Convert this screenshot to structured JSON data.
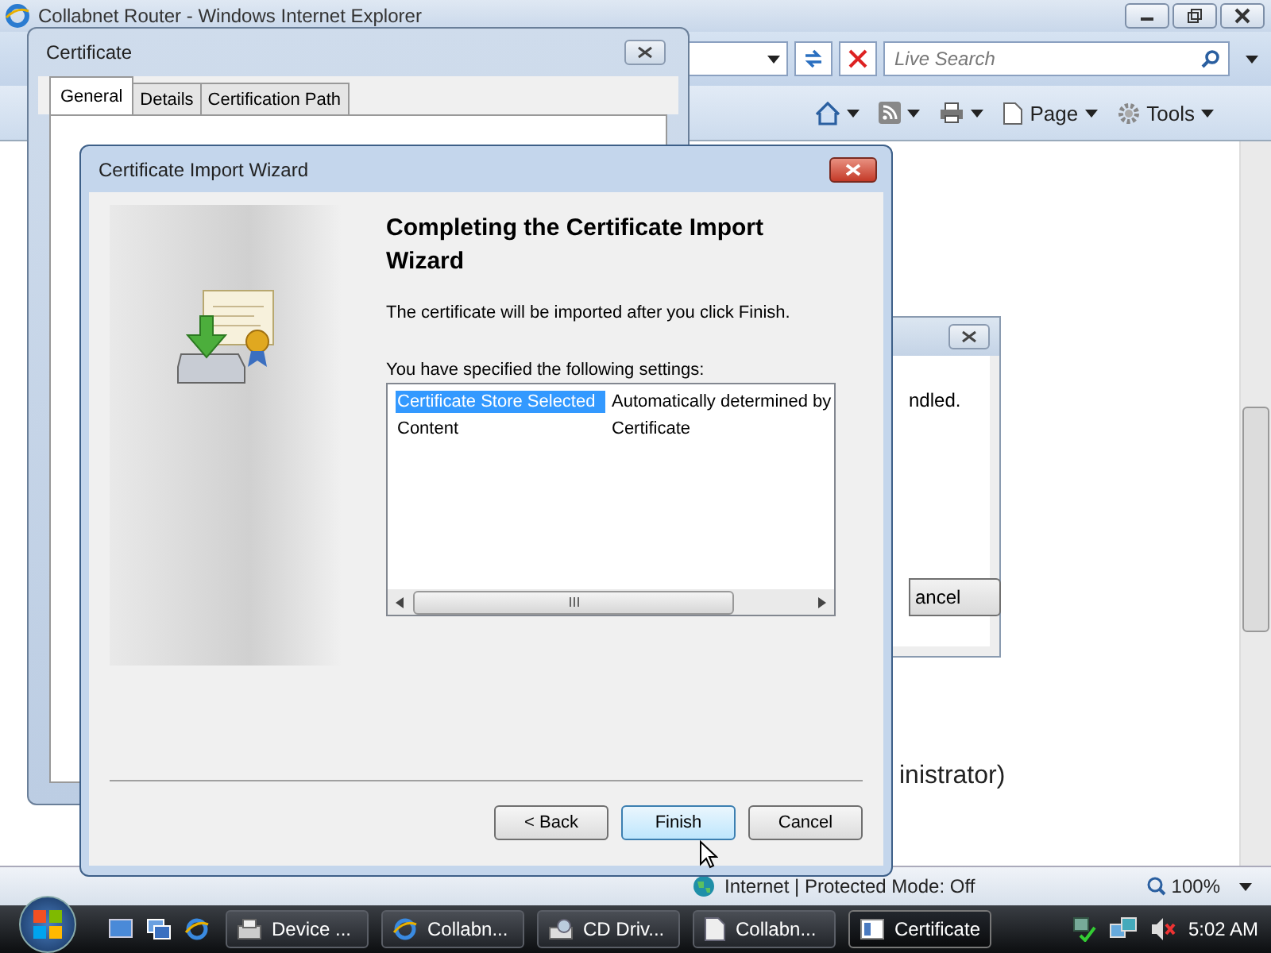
{
  "browser": {
    "title": "Collabnet Router - Windows Internet Explorer",
    "search": {
      "placeholder": "Live Search"
    },
    "toolbar": [
      {
        "kind": "home"
      },
      {
        "kind": "feeds"
      },
      {
        "kind": "print"
      },
      {
        "kind": "page",
        "label": "Page"
      },
      {
        "kind": "tools",
        "label": "Tools"
      }
    ],
    "behind_dialog": {
      "text": "ndled.",
      "button": "ancel"
    },
    "page_text": "inistrator)",
    "status_bar": {
      "zone": "Internet | Protected Mode: Off",
      "zoom": "100%"
    }
  },
  "certificate": {
    "title": "Certificate",
    "tabs": [
      {
        "label": "General",
        "selected": true
      },
      {
        "label": "Details",
        "selected": false
      },
      {
        "label": "Certification Path",
        "selected": false
      }
    ]
  },
  "wizard": {
    "title": "Certificate Import Wizard",
    "heading": "Completing the Certificate Import Wizard",
    "info": "The certificate will be imported after you click Finish.",
    "settings_label": "You have specified the following settings:",
    "settings": [
      {
        "name": "Certificate Store Selected",
        "value": "Automatically determined by",
        "selected": true
      },
      {
        "name": "Content",
        "value": "Certificate",
        "selected": false
      }
    ],
    "buttons": [
      {
        "label": "< Back",
        "hovered": false
      },
      {
        "label": "Finish",
        "hovered": true
      },
      {
        "label": "Cancel",
        "hovered": false
      }
    ]
  },
  "taskbar": {
    "tasks": [
      {
        "label": "Device ...",
        "kind": "device",
        "selected": false
      },
      {
        "label": "Collabn...",
        "kind": "ie",
        "selected": false
      },
      {
        "label": "CD Driv...",
        "kind": "drive",
        "selected": false
      },
      {
        "label": "Collabn...",
        "kind": "doc",
        "selected": false
      },
      {
        "label": "Certificate",
        "kind": "cert",
        "selected": true
      }
    ],
    "clock": "5:02 AM"
  }
}
